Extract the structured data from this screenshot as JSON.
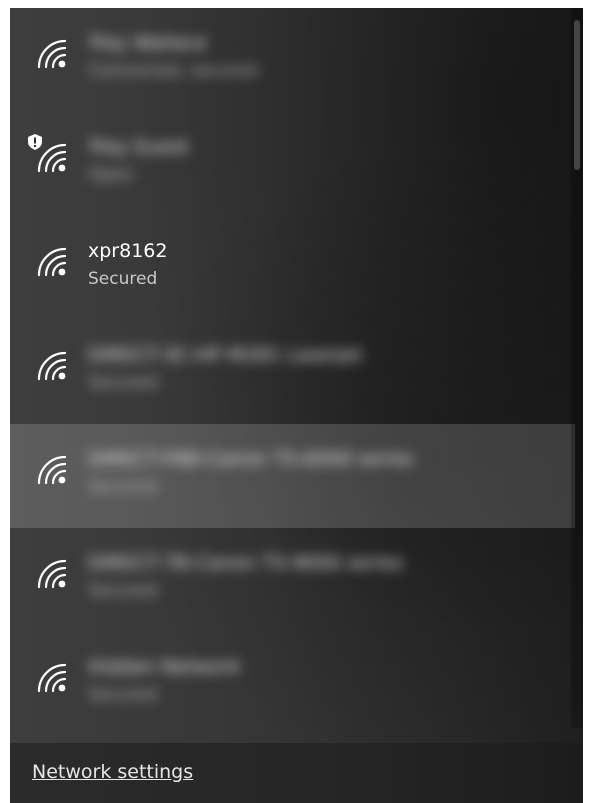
{
  "networks": [
    {
      "ssid": "Trey Wallace",
      "status": "Connected, secured",
      "shield": false,
      "obscured": true
    },
    {
      "ssid": "Trey Guest",
      "status": "Open",
      "shield": true,
      "obscured": true
    },
    {
      "ssid": "xpr8162",
      "status": "Secured",
      "shield": false,
      "obscured": false
    },
    {
      "ssid": "DIRECT-3C-HP M281 LaserJet",
      "status": "Secured",
      "shield": false,
      "obscured": true
    },
    {
      "ssid": "DIRECT-FB8-Canon TS-6000 series",
      "status": "Secured",
      "shield": false,
      "obscured": true,
      "hovered": true
    },
    {
      "ssid": "DIRECT-7B-Canon TS-9000 series",
      "status": "Secured",
      "shield": false,
      "obscured": true
    },
    {
      "ssid": "Hidden Network",
      "status": "Secured",
      "shield": false,
      "obscured": true
    }
  ],
  "footer": {
    "settings_label": "Network settings"
  },
  "icons": {
    "network": "wifi-signal-icon",
    "open_warning": "shield-warning-icon"
  }
}
